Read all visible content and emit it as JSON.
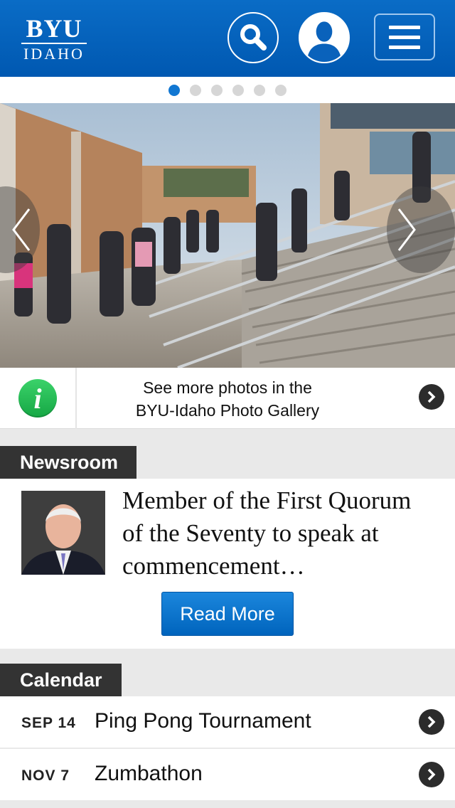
{
  "header": {
    "logo_top": "BYU",
    "logo_bottom": "IDAHO"
  },
  "carousel": {
    "slide_count": 6,
    "active_slide": 1
  },
  "gallery_info": {
    "line1": "See more photos in the",
    "line2": "BYU-Idaho Photo Gallery"
  },
  "newsroom": {
    "label": "Newsroom",
    "headline": "Member of the First Quorum of the Seventy to speak at commencement…",
    "button_label": "Read More"
  },
  "calendar": {
    "label": "Calendar",
    "events": [
      {
        "date": "SEP 14",
        "title": "Ping Pong Tournament"
      },
      {
        "date": "NOV 7",
        "title": "Zumbathon"
      }
    ]
  },
  "colors": {
    "header_blue": "#0a6cc6",
    "active_dot": "#1177d2",
    "info_green": "#22b24f",
    "label_dark": "#333333"
  }
}
